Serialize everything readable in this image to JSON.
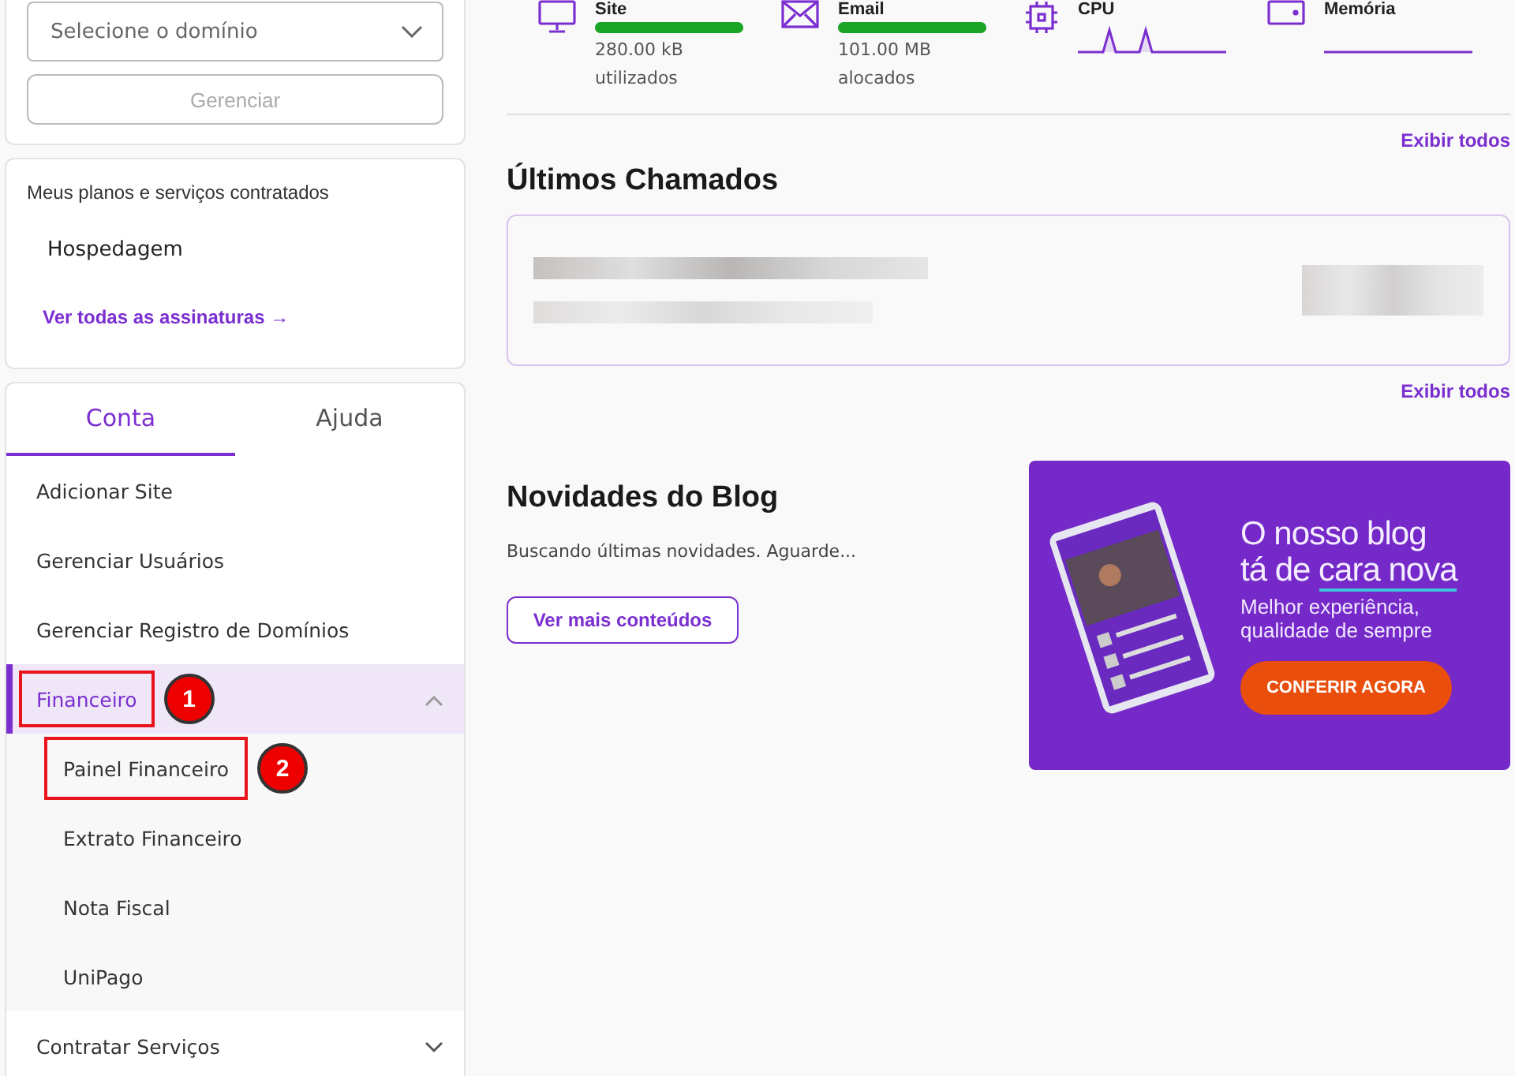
{
  "domain_select": {
    "placeholder": "Selecione o domínio"
  },
  "manage_button": {
    "label": "Gerenciar",
    "disabled": true
  },
  "plans": {
    "title": "Meus planos e serviços contratados",
    "items": [
      "Hospedagem"
    ],
    "link": "Ver todas as assinaturas →"
  },
  "tabs": [
    {
      "label": "Conta",
      "selected": true
    },
    {
      "label": "Ajuda",
      "selected": false
    }
  ],
  "menu": [
    {
      "label": "Adicionar Site"
    },
    {
      "label": "Gerenciar Usuários"
    },
    {
      "label": "Gerenciar Registro de Domínios"
    },
    {
      "label": "Financeiro",
      "expanded": true,
      "selected": true,
      "annotation": "1",
      "children": [
        {
          "label": "Painel Financeiro",
          "annotation": "2"
        },
        {
          "label": "Extrato Financeiro"
        },
        {
          "label": "Nota Fiscal"
        },
        {
          "label": "UniPago"
        }
      ]
    },
    {
      "label": "Contratar Serviços",
      "expanded": false,
      "selected": false
    }
  ],
  "metrics": [
    {
      "kind": "bar",
      "label": "Site",
      "level": 1,
      "value": "280.00 kB",
      "caption": "utilizados"
    },
    {
      "kind": "bar",
      "label": "Email",
      "level": 1,
      "value": "101.00 MB",
      "caption": "alocados"
    },
    {
      "kind": "sparkline",
      "label": "CPU"
    },
    {
      "kind": "flatline",
      "label": "Memória"
    }
  ],
  "show_all_1": "Exibir todos",
  "tickets": {
    "title": "Últimos Chamados"
  },
  "show_all_2": "Exibir todos",
  "blog": {
    "title": "Novidades do Blog",
    "status": "Buscando últimas novidades. Aguarde...",
    "button": "Ver mais conteúdos"
  },
  "banner": {
    "headline_1": "O nosso blog",
    "headline_2a": "tá de ",
    "headline_2b": "cara nova",
    "subtitle": "Melhor experiência, qualidade de sempre",
    "button": "CONFERIR AGORA"
  }
}
